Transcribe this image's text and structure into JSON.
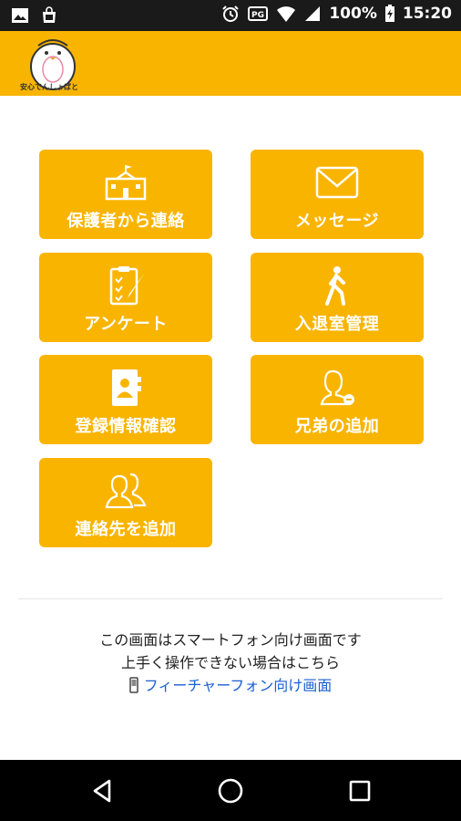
{
  "status_bar": {
    "battery": "100%",
    "time": "15:20",
    "icons": [
      "image-icon",
      "store-icon",
      "alarm-icon",
      "vibrate-icon",
      "wifi-icon",
      "signal-icon",
      "battery-charging-icon"
    ]
  },
  "header": {
    "logo_text": "安心でんしょばと",
    "bg_color": "#F9B400"
  },
  "tiles": [
    {
      "label": "保護者から連絡",
      "icon": "school-icon"
    },
    {
      "label": "メッセージ",
      "icon": "envelope-icon"
    },
    {
      "label": "アンケート",
      "icon": "clipboard-icon"
    },
    {
      "label": "入退室管理",
      "icon": "walking-person-icon"
    },
    {
      "label": "登録情報確認",
      "icon": "contact-card-icon"
    },
    {
      "label": "兄弟の追加",
      "icon": "add-person-icon"
    },
    {
      "label": "連絡先を追加",
      "icon": "two-people-icon"
    }
  ],
  "footer": {
    "line1": "この画面はスマートフォン向け画面です",
    "line2": "上手く操作できない場合はこちら",
    "link": "フィーチャーフォン向け画面"
  },
  "nav": {
    "icons": [
      "back-icon",
      "home-icon",
      "recents-icon"
    ]
  }
}
